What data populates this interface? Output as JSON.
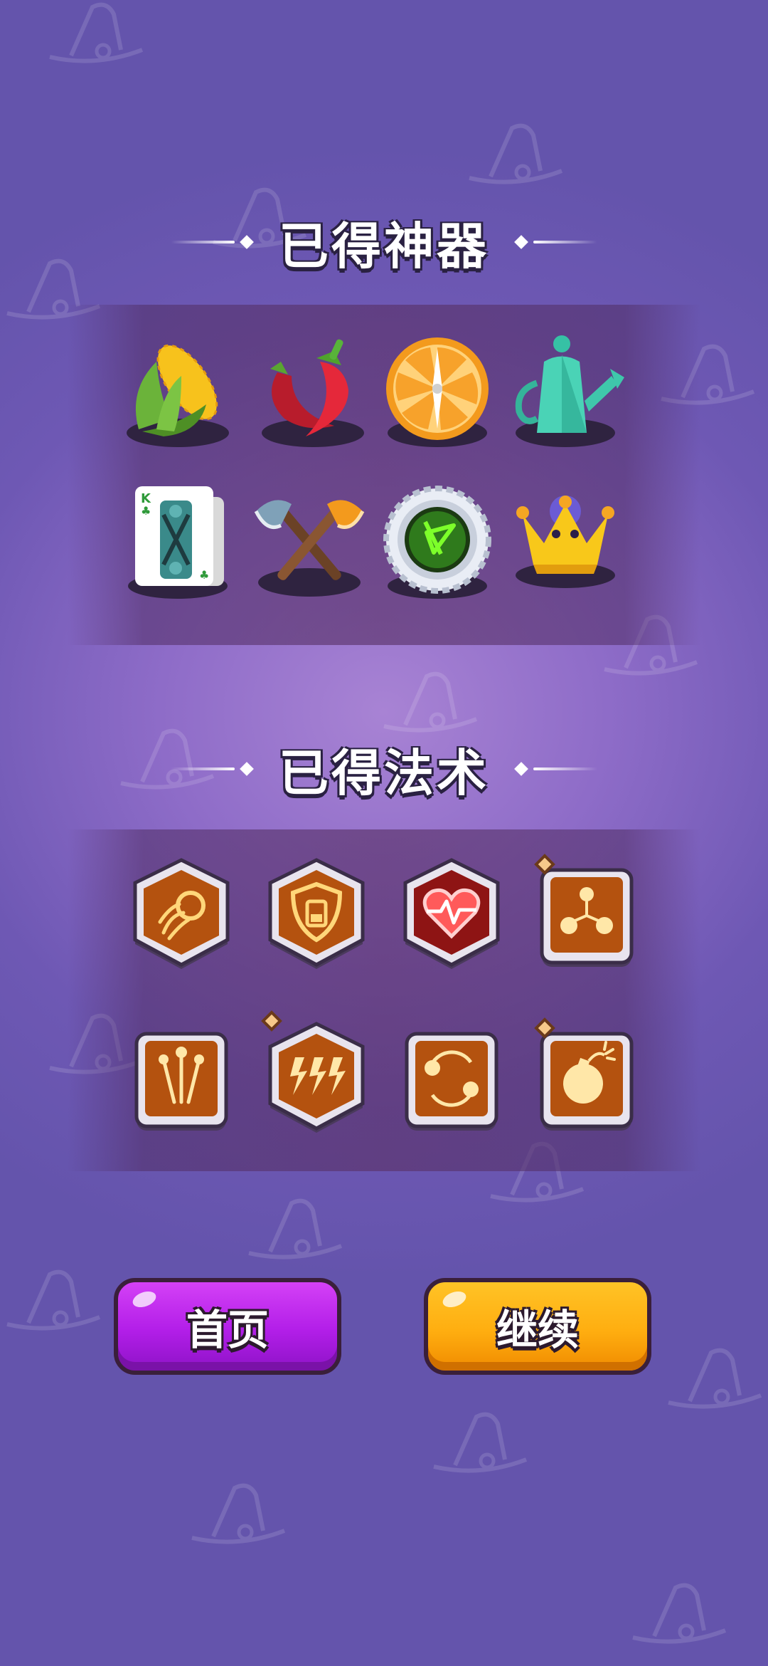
{
  "artifacts": {
    "title": "已得神器",
    "items": [
      {
        "name": "corn-icon"
      },
      {
        "name": "chili-pepper-icon"
      },
      {
        "name": "orange-slice-compass-icon"
      },
      {
        "name": "watering-can-icon"
      },
      {
        "name": "king-card-icon"
      },
      {
        "name": "crossed-axes-icon"
      },
      {
        "name": "bottle-cap-icon"
      },
      {
        "name": "crown-icon"
      }
    ]
  },
  "spells": {
    "title": "已得法术",
    "items": [
      {
        "name": "fireball-spell-icon",
        "frame": "hex",
        "rare": false
      },
      {
        "name": "shield-spell-icon",
        "frame": "hex",
        "rare": false
      },
      {
        "name": "heartbeat-spell-icon",
        "frame": "hex",
        "rare": false
      },
      {
        "name": "split-orbs-spell-icon",
        "frame": "square",
        "rare": true
      },
      {
        "name": "triple-shot-spell-icon",
        "frame": "square",
        "rare": false
      },
      {
        "name": "lightning-spell-icon",
        "frame": "hex",
        "rare": true
      },
      {
        "name": "orbit-spell-icon",
        "frame": "square",
        "rare": false
      },
      {
        "name": "bomb-spell-icon",
        "frame": "square",
        "rare": true
      }
    ]
  },
  "buttons": {
    "home_label": "首页",
    "continue_label": "继续"
  },
  "colors": {
    "background": "#6e58b4",
    "home_button": "#b21ee8",
    "continue_button": "#ffae10",
    "spell_frame_inner": "#b4520f"
  }
}
